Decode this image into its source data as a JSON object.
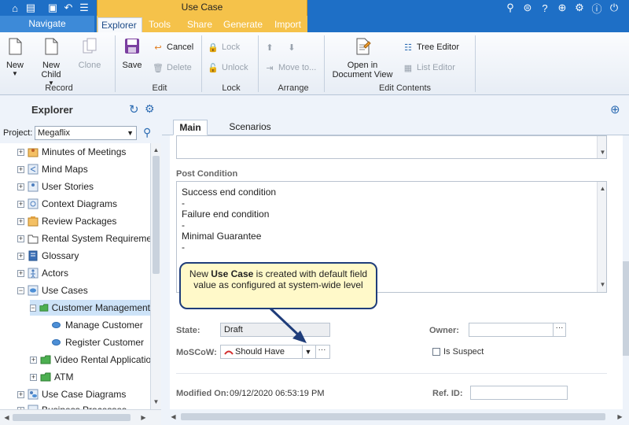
{
  "app": {
    "title": "Use Case",
    "navigate_label": "Navigate"
  },
  "tabs": [
    {
      "label": "Explorer",
      "active": true
    },
    {
      "label": "Tools"
    },
    {
      "label": "Share"
    },
    {
      "label": "Generate"
    },
    {
      "label": "Import"
    }
  ],
  "ribbon": {
    "record": {
      "label": "Record",
      "new": "New",
      "new_child": "New Child",
      "clone": "Clone"
    },
    "edit": {
      "label": "Edit",
      "save": "Save",
      "cancel": "Cancel",
      "delete": "Delete"
    },
    "lock": {
      "label": "Lock",
      "lock": "Lock",
      "unlock": "Unlock"
    },
    "arrange": {
      "label": "Arrange",
      "move_to": "Move to..."
    },
    "edit_contents": {
      "label": "Edit Contents",
      "open_in_doc_line1": "Open in",
      "open_in_doc_line2": "Document View",
      "tree_editor": "Tree Editor",
      "list_editor": "List Editor"
    }
  },
  "explorer": {
    "title": "Explorer",
    "project_label": "Project:",
    "project_value": "Megaflix",
    "tree": [
      {
        "label": "Minutes of Meetings",
        "level": 0,
        "expander": "+"
      },
      {
        "label": "Mind Maps",
        "level": 0,
        "expander": "+"
      },
      {
        "label": "User Stories",
        "level": 0,
        "expander": "+"
      },
      {
        "label": "Context Diagrams",
        "level": 0,
        "expander": "+"
      },
      {
        "label": "Review Packages",
        "level": 0,
        "expander": "+"
      },
      {
        "label": "Rental System Requiremer",
        "level": 0,
        "expander": "+"
      },
      {
        "label": "Glossary",
        "level": 0,
        "expander": "+"
      },
      {
        "label": "Actors",
        "level": 0,
        "expander": "+"
      },
      {
        "label": "Use Cases",
        "level": 0,
        "expander": "−"
      },
      {
        "label": "Customer Management",
        "level": 1,
        "expander": "−",
        "selected": true
      },
      {
        "label": "Manage Customer",
        "level": 2,
        "expander": ""
      },
      {
        "label": "Register Customer",
        "level": 2,
        "expander": ""
      },
      {
        "label": "Video Rental Applicatio",
        "level": 1,
        "expander": "+"
      },
      {
        "label": "ATM",
        "level": 1,
        "expander": "+"
      },
      {
        "label": "Use Case Diagrams",
        "level": 0,
        "expander": "+"
      },
      {
        "label": "Business Processes",
        "level": 0,
        "expander": "+"
      }
    ]
  },
  "form": {
    "tabs": [
      "Main",
      "Scenarios"
    ],
    "post_condition_label": "Post Condition",
    "post_condition_lines": [
      "Success end condition",
      "-",
      "Failure end condition",
      "-",
      "Minimal Guarantee",
      "-"
    ],
    "state_label": "State:",
    "state_value": "Draft",
    "owner_label": "Owner:",
    "owner_value": "",
    "moscow_label": "MoSCoW:",
    "moscow_value": "Should Have",
    "is_suspect_label": "Is Suspect",
    "modified_on_label": "Modified On:",
    "modified_on_value": "09/12/2020 06:53:19 PM",
    "ref_id_label": "Ref. ID:",
    "ref_id_value": ""
  },
  "callout": {
    "before": "New ",
    "bold": "Use Case",
    "after": " is created with default field value as configured at system-wide level"
  },
  "colors": {
    "topbar": "#1e6fc6",
    "context_tab": "#f5c24a",
    "callout_bg": "#fff9c9",
    "callout_border": "#1f3d7a"
  }
}
